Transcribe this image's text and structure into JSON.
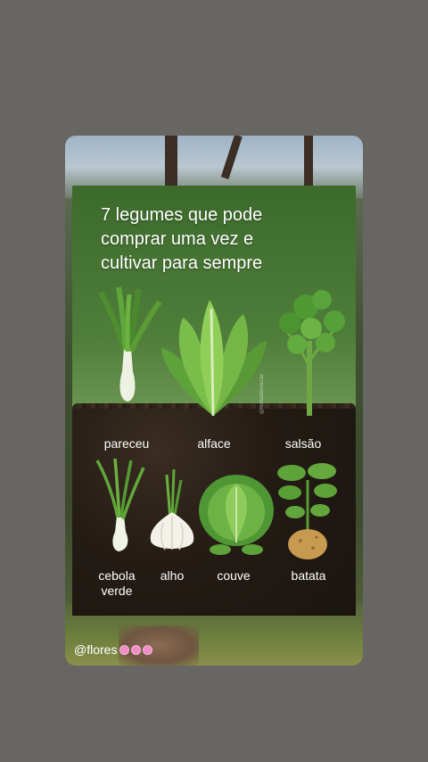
{
  "post": {
    "title_lines": [
      "7 legumes que pode",
      "comprar uma vez e",
      "cultivar para sempre"
    ],
    "watermark": "@hortastecnicas",
    "vegetables": [
      {
        "label": "pareceu",
        "icon": "leek-icon"
      },
      {
        "label": "alface",
        "icon": "lettuce-icon"
      },
      {
        "label": "salsão",
        "icon": "celery-icon"
      },
      {
        "label_lines": [
          "cebola",
          "verde"
        ],
        "icon": "green-onion-icon"
      },
      {
        "label": "alho",
        "icon": "garlic-icon"
      },
      {
        "label": "couve",
        "icon": "cabbage-icon"
      },
      {
        "label": "batata",
        "icon": "potato-plant-icon"
      }
    ]
  },
  "footer": {
    "handle": "@flores",
    "decoration": "flower-emoji-icons",
    "decoration_color": "#f08cc6"
  }
}
